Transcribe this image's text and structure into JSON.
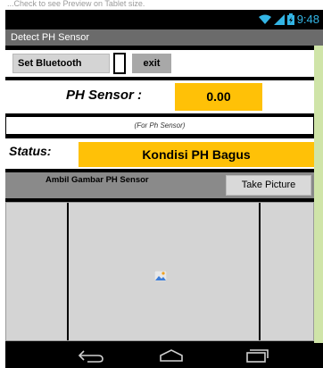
{
  "hint_text": "...Check to see Preview on Tablet size.",
  "status_bar": {
    "time": "9:48"
  },
  "app": {
    "title": "Detect PH Sensor"
  },
  "buttons": {
    "set_bluetooth": "Set Bluetooth",
    "exit": "exit",
    "take_picture": "Take Picture"
  },
  "ph": {
    "label": "PH Sensor :",
    "value": "0.00",
    "note": "(For Ph Sensor)"
  },
  "status": {
    "label": "Status:",
    "value": "Kondisi PH Bagus"
  },
  "capture": {
    "label": "Ambil Gambar PH Sensor"
  },
  "colors": {
    "accent": "#ffc107",
    "titlebar": "#6b6b6b",
    "statusbar_icons": "#33b5e5"
  }
}
